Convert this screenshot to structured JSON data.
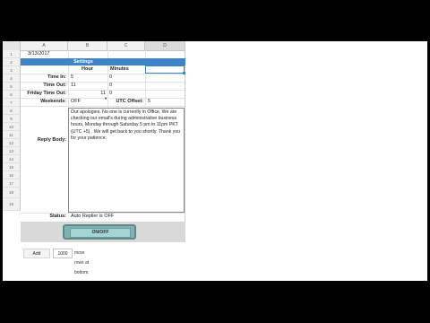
{
  "columns": [
    "A",
    "B",
    "C",
    "D"
  ],
  "rows": [
    "1",
    "2",
    "3",
    "4",
    "5",
    "6",
    "7",
    "8",
    "9",
    "10",
    "11",
    "12",
    "13",
    "14",
    "15",
    "16",
    "17",
    "18",
    "19"
  ],
  "date": "3/13/2017",
  "settings_title": "Settings",
  "headers": {
    "hour": "Hour",
    "minutes": "Minutes"
  },
  "time_in": {
    "label": "Time In:",
    "hour": "5",
    "minutes": "0"
  },
  "time_out": {
    "label": "Time Out:",
    "hour": "11",
    "minutes": "0"
  },
  "friday_time_out": {
    "label": "Friday Time Out:",
    "hour": "11",
    "minutes": "0"
  },
  "weekends": {
    "label": "Weekends:",
    "value": "OFF"
  },
  "utc_offset": {
    "label": "UTC Offset:",
    "value": "5"
  },
  "reply_body": {
    "label": "Reply Body:",
    "text": "Our apologies, No one is currently in Office. We are checking our email's during administrative business hours, Monday through Saturday 5 pm to 11pm PKT (UTC +5) . We will get back to you shortly. Thank you for your patience."
  },
  "status": {
    "label": "Status:",
    "value": "Auto Replier is OFF"
  },
  "toggle_label": "ON/OFF",
  "add_rows": {
    "button": "Add",
    "count": "1000",
    "label": "more rows at bottom."
  }
}
